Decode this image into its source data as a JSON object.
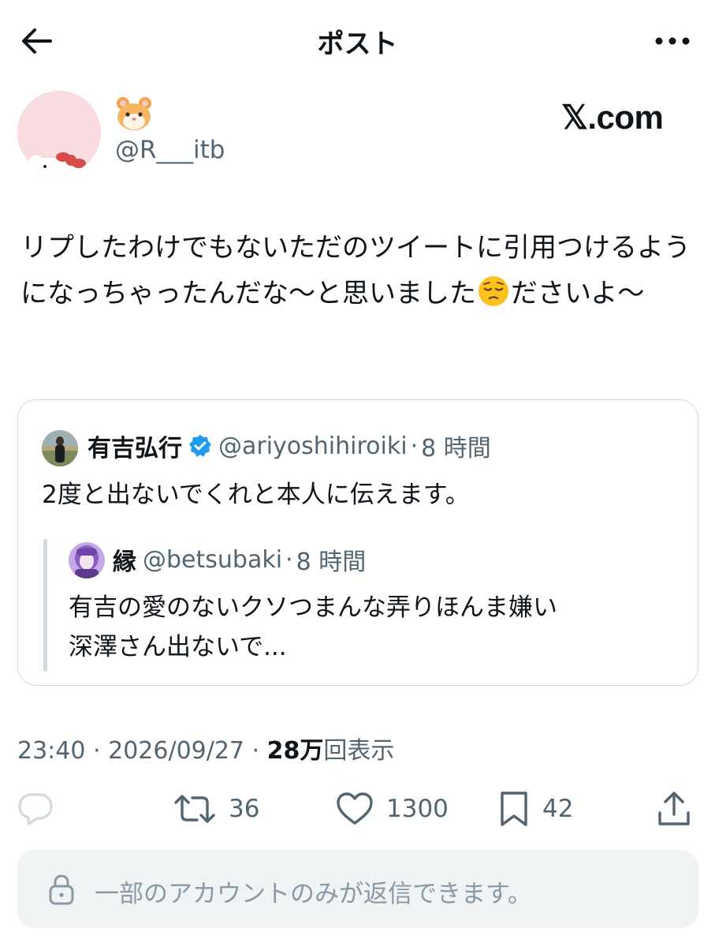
{
  "header": {
    "title": "ポスト"
  },
  "author": {
    "name_emoji": "🐹",
    "handle": "@R___itb",
    "watermark": "𝕏.com"
  },
  "post": {
    "text_part1": "リプしたわけでもないただのツイートに引用つけるようになっちゃったんだな〜と思いました",
    "emoji": "😔",
    "text_part2": "ださいよ〜"
  },
  "quote": {
    "name": "有吉弘行",
    "handle": "@ariyoshihiroiki",
    "separator": "·",
    "time": "8 時間",
    "text": "2度と出ないでくれと本人に伝えます。",
    "nested": {
      "name": "縁",
      "handle": "@betsubaki",
      "separator": "·",
      "time": "8 時間",
      "line1": "有吉の愛のないクソつまんな弄りほんま嫌い",
      "line2": "深澤さん出ないで..."
    }
  },
  "meta": {
    "time": "23:40",
    "date": "2026/09/27",
    "sep": "·",
    "views_count": "28万",
    "views_label": "回表示"
  },
  "actions": {
    "reposts": "36",
    "likes": "1300",
    "bookmarks": "42"
  },
  "reply_bar": {
    "text": "一部のアカウントのみが返信できます。"
  },
  "colors": {
    "text": "#0f1419",
    "secondary": "#536471",
    "border": "#cfd9de",
    "verified": "#1d9bf0",
    "reply_bg": "#eff3f4"
  }
}
